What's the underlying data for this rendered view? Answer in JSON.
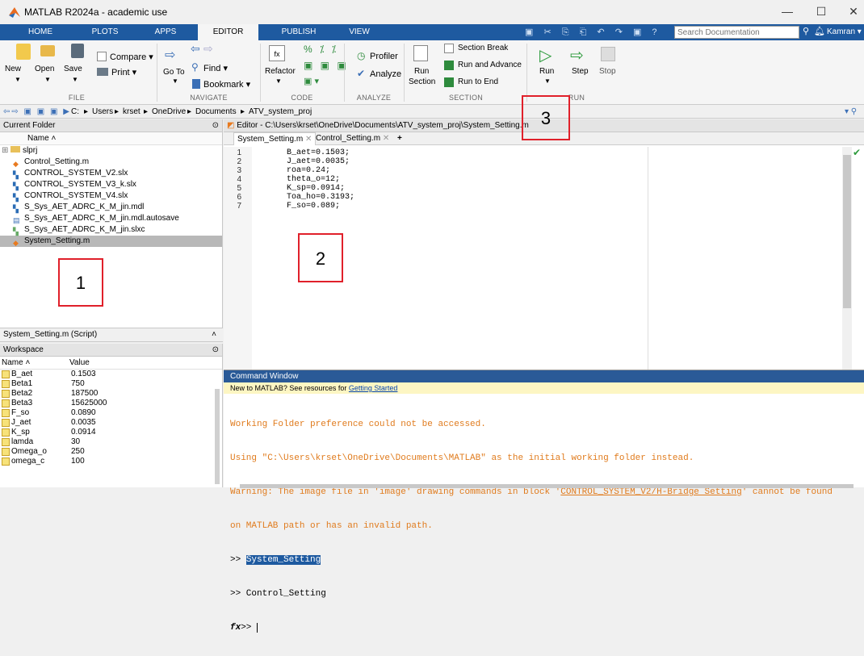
{
  "window": {
    "title": "MATLAB R2024a - academic use",
    "min": "—",
    "max": "☐",
    "close": "✕"
  },
  "tabs": [
    "HOME",
    "PLOTS",
    "APPS",
    "EDITOR",
    "PUBLISH",
    "VIEW"
  ],
  "search": {
    "placeholder": "Search Documentation",
    "user": "Kamran ▾"
  },
  "ribbon": {
    "new": "New",
    "open": "Open",
    "save": "Save",
    "compare": "Compare ▾",
    "print": "Print ▾",
    "goto": "Go To",
    "find": "Find ▾",
    "bookmark": "Bookmark ▾",
    "refactor": "Refactor",
    "profiler": "Profiler",
    "analyze": "Analyze",
    "run_section": "Run",
    "run_section2": "Section",
    "section_break": "Section Break",
    "run_advance": "Run and Advance",
    "run_end": "Run to End",
    "run": "Run",
    "step": "Step",
    "stop": "Stop",
    "groups": {
      "file": "FILE",
      "navigate": "NAVIGATE",
      "code": "CODE",
      "analyze": "ANALYZE",
      "section": "SECTION",
      "run": "RUN"
    }
  },
  "path": [
    "C:",
    "Users",
    "krset",
    "OneDrive",
    "Documents",
    "ATV_system_proj"
  ],
  "current_folder": {
    "title": "Current Folder",
    "col": "Name ˄",
    "items": [
      "slprj",
      "Control_Setting.m",
      "CONTROL_SYSTEM_V2.slx",
      "CONTROL_SYSTEM_V3_k.slx",
      "CONTROL_SYSTEM_V4.slx",
      "S_Sys_AET_ADRC_K_M_jin.mdl",
      "S_Sys_AET_ADRC_K_M_jin.mdl.autosave",
      "S_Sys_AET_ADRC_K_M_jin.slxc",
      "System_Setting.m"
    ],
    "details": "System_Setting.m  (Script)"
  },
  "workspace": {
    "title": "Workspace",
    "col_name": "Name ˄",
    "col_value": "Value",
    "rows": [
      [
        "B_aet",
        "0.1503"
      ],
      [
        "Beta1",
        "750"
      ],
      [
        "Beta2",
        "187500"
      ],
      [
        "Beta3",
        "15625000"
      ],
      [
        "F_so",
        "0.0890"
      ],
      [
        "J_aet",
        "0.0035"
      ],
      [
        "K_sp",
        "0.0914"
      ],
      [
        "lamda",
        "30"
      ],
      [
        "Omega_o",
        "250"
      ],
      [
        "omega_c",
        "100"
      ]
    ]
  },
  "editor": {
    "title": "Editor - C:\\Users\\krset\\OneDrive\\Documents\\ATV_system_proj\\System_Setting.m",
    "tabs": [
      "System_Setting.m",
      "Control_Setting.m"
    ],
    "tab_close": "✕",
    "tab_add": "+",
    "lines": [
      "B_aet=0.1503;",
      "J_aet=0.0035;",
      "roa=0.24;",
      "theta_o=12;",
      "K_sp=0.0914;",
      "Toa_ho=0.3193;",
      "F_so=0.089;"
    ],
    "line_nums": [
      "1",
      "2",
      "3",
      "4",
      "5",
      "6",
      "7"
    ]
  },
  "command": {
    "title": "Command Window",
    "banner": "New to MATLAB? See resources for ",
    "banner_link": "Getting Started",
    "l1": "Working Folder preference could not be accessed.",
    "l2": "Using \"C:\\Users\\krset\\OneDrive\\Documents\\MATLAB\" as the initial working folder instead.",
    "l3a": "Warning: The image file in 'image' drawing commands in block '",
    "l3link": "CONTROL_SYSTEM_V2/H-Bridge Setting",
    "l3b": "' cannot be found",
    "l4": "on MATLAB path or has an invalid path.",
    "p1": ">> ",
    "c1": "System_Setting",
    "p2": ">> Control_Setting",
    "prompt": ">> "
  },
  "annotations": [
    "1",
    "2",
    "3"
  ]
}
